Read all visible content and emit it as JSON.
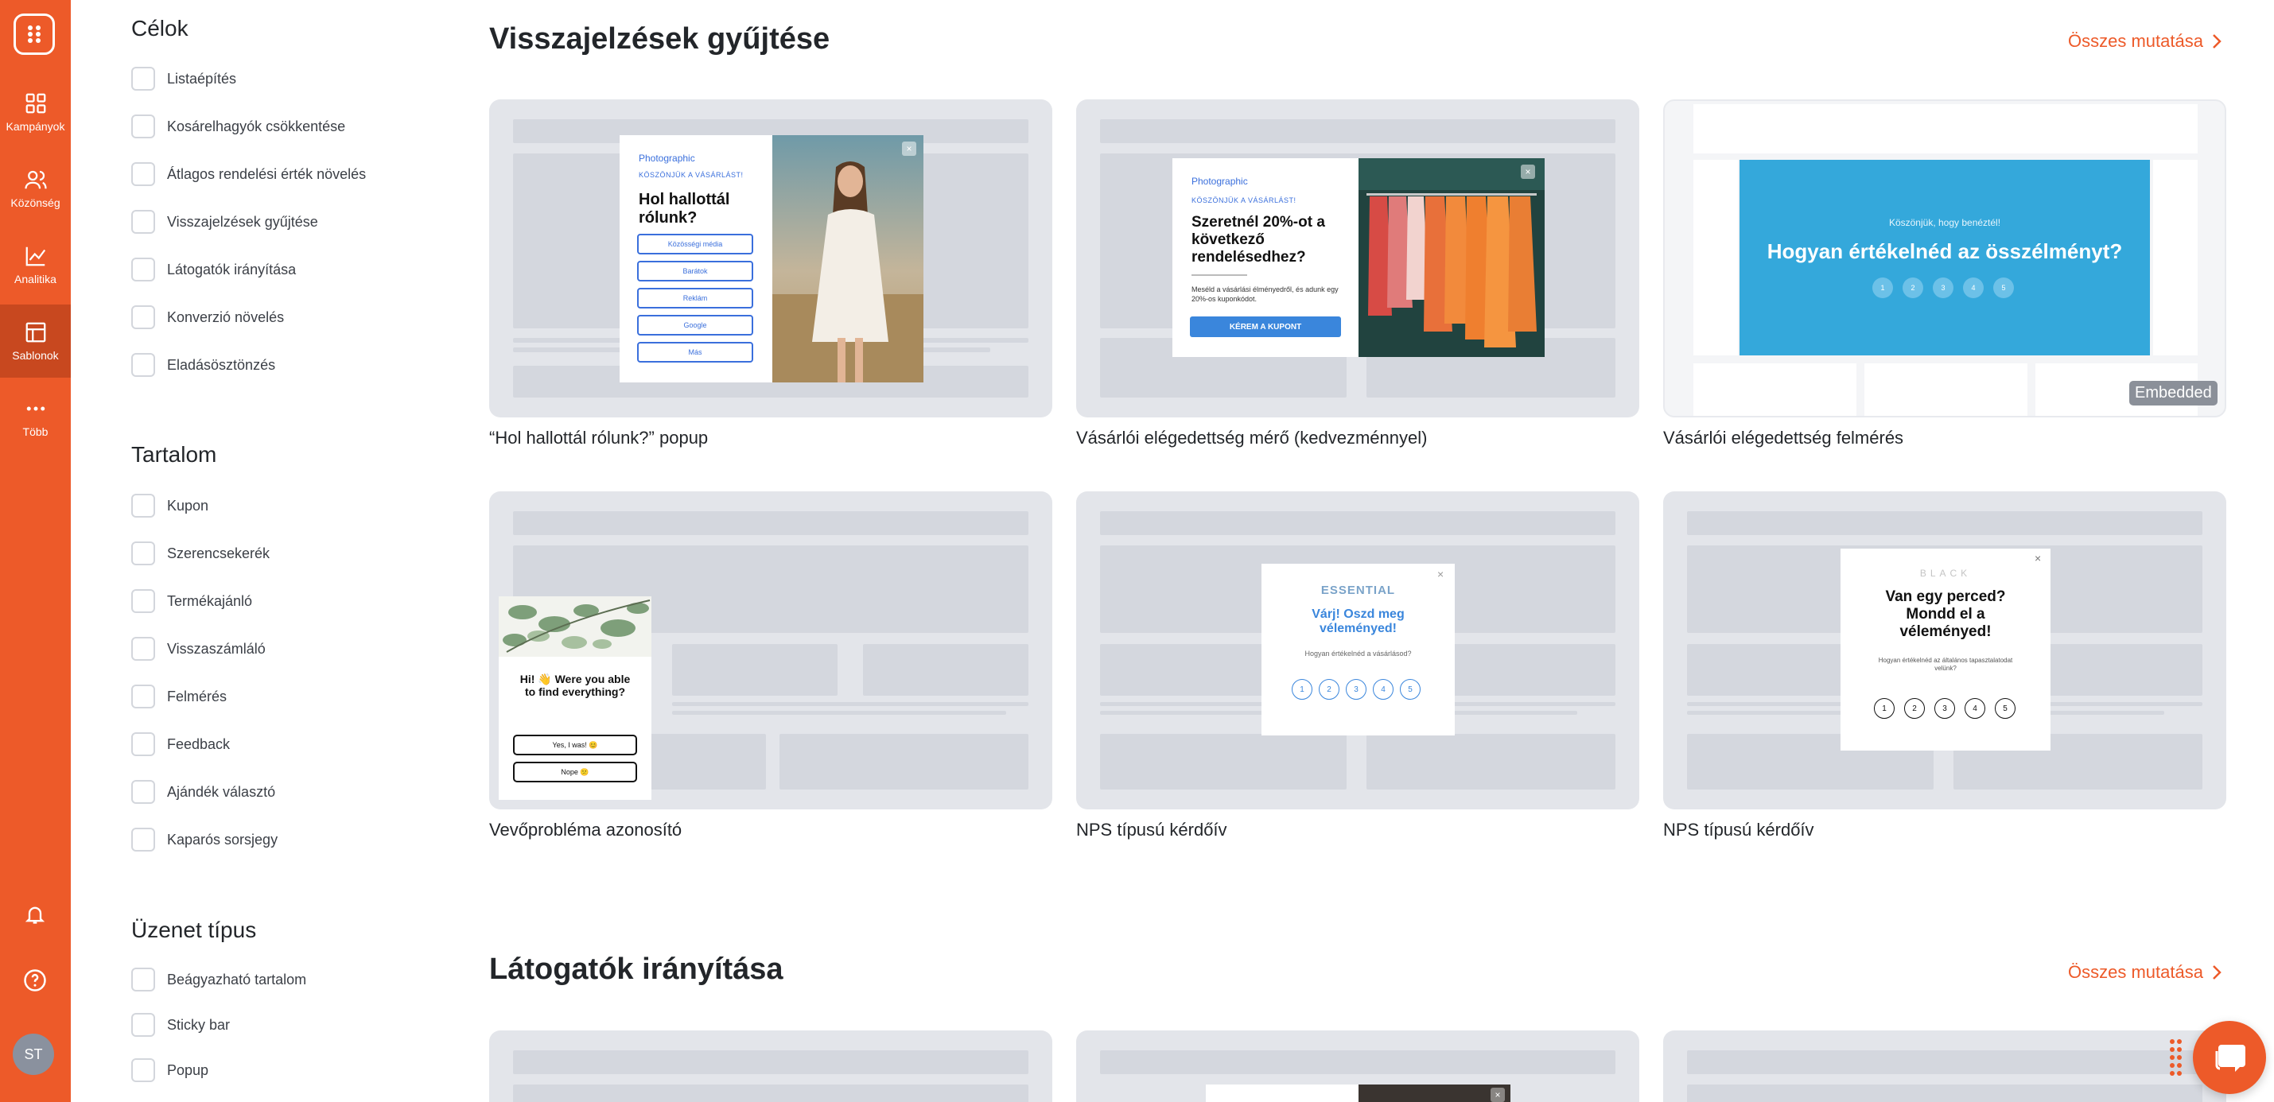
{
  "colors": {
    "accent": "#ed5a29",
    "rail_active": "#c8481f",
    "embedded_blue": "#34a8db",
    "popup_blue": "#3a86dc"
  },
  "rail": {
    "items": [
      {
        "label": "Kampányok",
        "icon": "grid-icon"
      },
      {
        "label": "Közönség",
        "icon": "users-icon"
      },
      {
        "label": "Analitika",
        "icon": "chart-line-icon"
      },
      {
        "label": "Sablonok",
        "icon": "template-icon",
        "active": true
      },
      {
        "label": "Több",
        "icon": "more-dots-icon"
      }
    ],
    "bottom_icons": [
      "bell-icon",
      "help-icon"
    ],
    "avatar_initials": "ST"
  },
  "filters": {
    "goals": {
      "title": "Célok",
      "options": [
        "Listaépítés",
        "Kosárelhagyók csökkentése",
        "Átlagos rendelési érték növelés",
        "Visszajelzések gyűjtése",
        "Látogatók irányítása",
        "Konverzió növelés",
        "Eladásösztönzés"
      ]
    },
    "content": {
      "title": "Tartalom",
      "options": [
        "Kupon",
        "Szerencsekerék",
        "Termékajánló",
        "Visszaszámláló",
        "Felmérés",
        "Feedback",
        "Ajándék választó",
        "Kaparós sorsjegy"
      ]
    },
    "message_type": {
      "title": "Üzenet típus",
      "options": [
        "Beágyazható tartalom",
        "Sticky bar",
        "Popup"
      ]
    }
  },
  "sections": [
    {
      "title": "Visszajelzések gyűjtése",
      "show_all": "Összes mutatása",
      "cards": [
        {
          "caption": "“Hol hallottál rólunk?” popup",
          "preview": {
            "brand": "Photographic",
            "kicker": "KÖSZÖNJÜK A VÁSÁRLÁST!",
            "headline": "Hol hallottál rólunk?",
            "options": [
              "Közösségi média",
              "Barátok",
              "Reklám",
              "Google",
              "Más"
            ]
          }
        },
        {
          "caption": "Vásárlói elégedettség mérő (kedvezménnyel)",
          "preview": {
            "brand": "Photographic",
            "kicker": "KÖSZÖNJÜK A VÁSÁRLÁST!",
            "headline": "Szeretnél 20%-ot a következő rendelésedhez?",
            "body": "Meséld a vásárlási élményedről, és adunk egy 20%-os kuponkódot.",
            "button": "KÉREM A KUPONT"
          }
        },
        {
          "caption": "Vásárlói elégedettség felmérés",
          "badge": "Embedded",
          "preview": {
            "kicker": "Köszönjük, hogy benéztél!",
            "headline": "Hogyan értékelnéd az összélményt?",
            "scale": [
              "1",
              "2",
              "3",
              "4",
              "5"
            ]
          }
        },
        {
          "caption": "Vevőprobléma azonosító",
          "preview": {
            "headline": "Hi! 👋 Were you able to find everything?",
            "options": [
              "Yes, I was! 😊",
              "Nope 😕"
            ]
          }
        },
        {
          "caption": "NPS típusú kérdőív",
          "preview": {
            "brand": "ESSENTIAL",
            "headline": "Várj! Oszd meg véleményed!",
            "question": "Hogyan értékelnéd a vásárlásod?",
            "scale": [
              "1",
              "2",
              "3",
              "4",
              "5"
            ]
          }
        },
        {
          "caption": "NPS típusú kérdőív",
          "preview": {
            "brand": "BLACK",
            "headline": "Van egy perced? Mondd el a véleményed!",
            "question": "Hogyan értékelnéd az általános tapasztalatodat velünk?",
            "scale": [
              "1",
              "2",
              "3",
              "4",
              "5"
            ]
          }
        }
      ]
    },
    {
      "title": "Látogatók irányítása",
      "show_all": "Összes mutatása"
    }
  ],
  "chat_icon": "chat-bubble-icon"
}
